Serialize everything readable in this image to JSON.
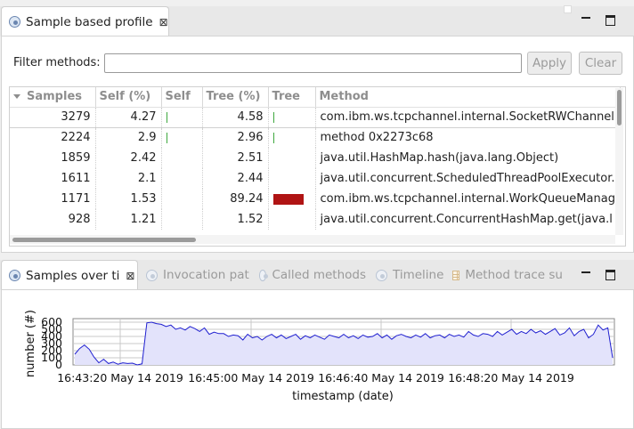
{
  "top_view": {
    "tab_title": "Sample based profile",
    "filter_label": "Filter methods:",
    "filter_value": "",
    "filter_placeholder": "",
    "apply_label": "Apply",
    "clear_label": "Clear"
  },
  "table": {
    "columns": [
      "Samples",
      "Self (%)",
      "Self",
      "Tree (%)",
      "Tree",
      "Method"
    ],
    "sorted_column": "Samples",
    "rows": [
      {
        "samples": "3279",
        "self_pct": "4.27",
        "self_bar": 0.048,
        "tree_pct": "4.58",
        "tree_bar": 0.051,
        "method": "com.ibm.ws.tcpchannel.internal.SocketRWChannel"
      },
      {
        "samples": "2224",
        "self_pct": "2.9",
        "self_bar": 0.032,
        "tree_pct": "2.96",
        "tree_bar": 0.033,
        "method": "method 0x2273c68"
      },
      {
        "samples": "1859",
        "self_pct": "2.42",
        "self_bar": 0,
        "tree_pct": "2.51",
        "tree_bar": 0,
        "method": "java.util.HashMap.hash(java.lang.Object)"
      },
      {
        "samples": "1611",
        "self_pct": "2.1",
        "self_bar": 0,
        "tree_pct": "2.44",
        "tree_bar": 0,
        "method": "java.util.concurrent.ScheduledThreadPoolExecutor."
      },
      {
        "samples": "1171",
        "self_pct": "1.53",
        "self_bar": 0,
        "tree_pct": "89.24",
        "tree_bar": 1.0,
        "method": "com.ibm.ws.tcpchannel.internal.WorkQueueManag"
      },
      {
        "samples": "928",
        "self_pct": "1.21",
        "self_bar": 0,
        "tree_pct": "1.52",
        "tree_bar": 0,
        "method": "java.util.concurrent.ConcurrentHashMap.get(java.l"
      }
    ]
  },
  "bottom_tabs": [
    {
      "label": "Samples over ti",
      "icon": "profile-icon",
      "active": true
    },
    {
      "label": "Invocation pat",
      "icon": "profile-icon",
      "active": false
    },
    {
      "label": "Called methods",
      "icon": "profile-icon",
      "active": false
    },
    {
      "label": "Timeline",
      "icon": "profile-icon",
      "active": false
    },
    {
      "label": "Method trace su",
      "icon": "grid-icon",
      "active": false
    }
  ],
  "colors": {
    "tree_bar": "#b01414",
    "self_bar": "#3ea83e",
    "chart_line": "#1f1fd0",
    "chart_fill": "#e3e3fb"
  },
  "chart_data": {
    "type": "area",
    "xlabel": "timestamp (date)",
    "ylabel": "number (#)",
    "ylim": [
      0,
      650
    ],
    "yticks": [
      "0",
      "100",
      "200",
      "300",
      "400",
      "500",
      "600"
    ],
    "xticks": [
      "16:43:20 May 14 2019",
      "16:45:00 May 14 2019",
      "16:46:40 May 14 2019",
      "16:48:20 May 14 2019"
    ],
    "series": [
      {
        "values": [
          150,
          230,
          280,
          220,
          110,
          30,
          80,
          20,
          40,
          10,
          30,
          20,
          25,
          0,
          15,
          590,
          600,
          580,
          570,
          540,
          560,
          500,
          520,
          490,
          540,
          510,
          470,
          520,
          430,
          460,
          440,
          440,
          400,
          420,
          410,
          350,
          430,
          380,
          400,
          350,
          400,
          430,
          380,
          420,
          370,
          400,
          430,
          360,
          410,
          380,
          420,
          390,
          360,
          420,
          400,
          380,
          430,
          380,
          410,
          370,
          420,
          390,
          400,
          440,
          380,
          420,
          360,
          410,
          430,
          400,
          380,
          420,
          390,
          440,
          380,
          410,
          420,
          380,
          430,
          400,
          420,
          390,
          470,
          420,
          400,
          440,
          430,
          400,
          470,
          420,
          460,
          500,
          430,
          470,
          440,
          500,
          450,
          480,
          430,
          470,
          510,
          420,
          450,
          520,
          410,
          470,
          500,
          380,
          430,
          560,
          490,
          520,
          100
        ]
      }
    ]
  }
}
